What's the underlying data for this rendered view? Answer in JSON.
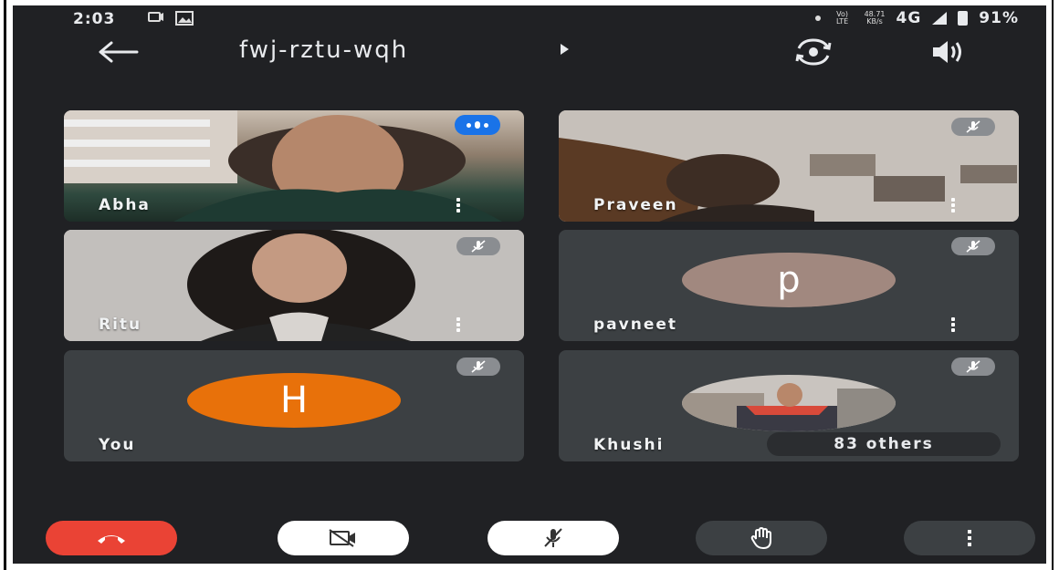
{
  "status_bar": {
    "time": "2:03",
    "network_small": "Vo) LTE",
    "speed_value": "48.71",
    "speed_unit": "KB/s",
    "network": "4G",
    "battery": "91%"
  },
  "header": {
    "meeting_code": "fwj-rztu-wqh"
  },
  "participants": [
    {
      "name": "Abha",
      "state": "speaking",
      "kind": "video"
    },
    {
      "name": "Praveen",
      "state": "muted",
      "kind": "video"
    },
    {
      "name": "Ritu",
      "state": "muted",
      "kind": "video"
    },
    {
      "name": "pavneet",
      "state": "muted",
      "kind": "initial",
      "initial": "p",
      "color": "#a1887f"
    },
    {
      "name": "You",
      "state": "muted",
      "kind": "initial",
      "initial": "H",
      "color": "#e8710a"
    },
    {
      "name": "Khushi",
      "state": "muted",
      "kind": "photo"
    }
  ],
  "others_count_label": "83 others",
  "colors": {
    "background": "#202124",
    "tile": "#3c4043",
    "end_call": "#ea4335",
    "speaking": "#1a73e8"
  },
  "controls": [
    {
      "name": "end-call-button",
      "icon": "phone-hangup-icon"
    },
    {
      "name": "camera-toggle-button",
      "icon": "camera-off-icon"
    },
    {
      "name": "mic-toggle-button",
      "icon": "mic-off-icon"
    },
    {
      "name": "raise-hand-button",
      "icon": "hand-icon"
    },
    {
      "name": "more-options-button",
      "icon": "more-vertical-icon"
    }
  ]
}
